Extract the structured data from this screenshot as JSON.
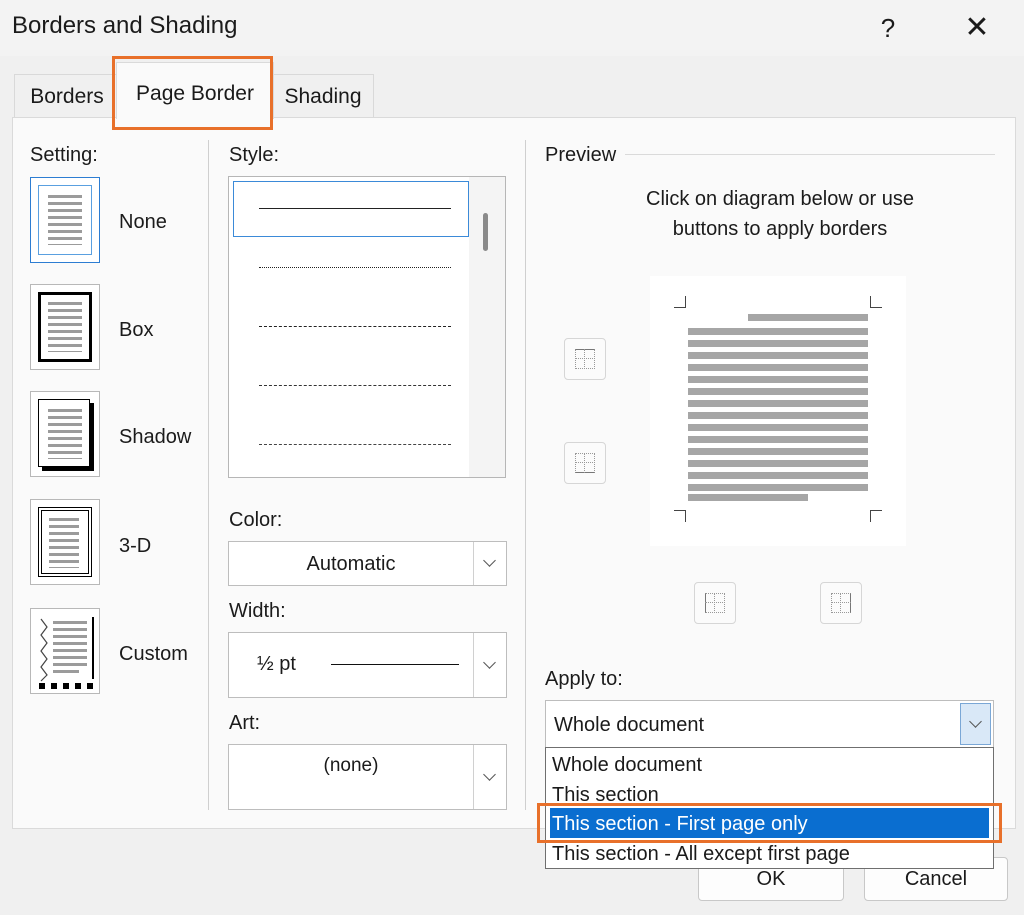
{
  "window": {
    "title": "Borders and Shading",
    "help_label": "?",
    "close_label": "✕"
  },
  "tabs": [
    {
      "label": "Borders",
      "active": false
    },
    {
      "label": "Page Border",
      "active": true
    },
    {
      "label": "Shading",
      "active": false
    }
  ],
  "setting": {
    "label": "Setting:",
    "items": [
      {
        "label": "None",
        "selected": true
      },
      {
        "label": "Box",
        "selected": false
      },
      {
        "label": "Shadow",
        "selected": false
      },
      {
        "label": "3-D",
        "selected": false
      },
      {
        "label": "Custom",
        "selected": false
      }
    ]
  },
  "style": {
    "label": "Style:",
    "options": [
      "solid",
      "dotted",
      "dashed-small",
      "dashed",
      "dash-dot"
    ],
    "selected_index": 0
  },
  "color": {
    "label": "Color:",
    "value": "Automatic"
  },
  "width": {
    "label": "Width:",
    "value": "½ pt"
  },
  "art": {
    "label": "Art:",
    "value": "(none)"
  },
  "preview": {
    "label": "Preview",
    "instruction_line1": "Click on diagram below or use",
    "instruction_line2": "buttons to apply borders",
    "buttons": [
      "top-border-icon",
      "bottom-border-icon",
      "left-border-icon",
      "right-border-icon"
    ]
  },
  "apply_to": {
    "label": "Apply to:",
    "value": "Whole document",
    "options": [
      "Whole document",
      "This section",
      "This section - First page only",
      "This section - All except first page"
    ],
    "highlighted_index": 2
  },
  "buttons": {
    "ok": "OK",
    "cancel": "Cancel"
  },
  "colors": {
    "highlight": "#e8702a",
    "selection": "#0a6ed0",
    "accent": "#2d7dd2"
  }
}
